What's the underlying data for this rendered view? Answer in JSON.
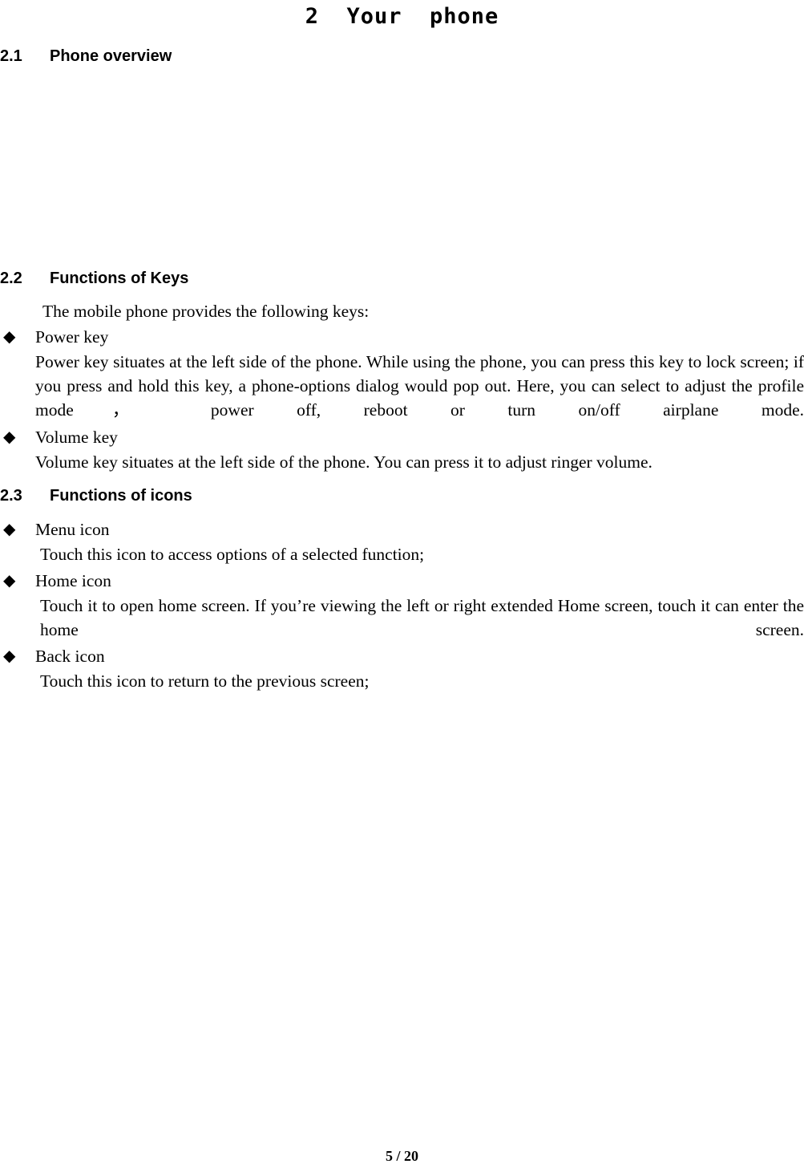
{
  "document": {
    "chapter_title": "2  Your  phone",
    "footer": "5 / 20"
  },
  "sections": [
    {
      "number": "2.1",
      "title": "Phone overview"
    },
    {
      "number": "2.2",
      "title": "Functions of Keys",
      "intro": "The mobile phone provides the following keys:",
      "items": [
        {
          "bullet": "◆",
          "label": "Power key",
          "body": "Power key situates at the left side of the phone. While using the phone, you can press this key to lock screen; if you press and hold this key, a phone-options dialog would pop out. Here, you can select to adjust the profile mode， power off, reboot or turn on/off airplane mode."
        },
        {
          "bullet": "◆",
          "label": "Volume key",
          "body": "Volume key situates at the left side of the phone. You can press it to adjust ringer volume."
        }
      ]
    },
    {
      "number": "2.3",
      "title": "Functions of icons",
      "items": [
        {
          "bullet": "◆",
          "label": "Menu icon",
          "body": "Touch this icon to access options of a selected function;"
        },
        {
          "bullet": "◆",
          "label": "Home icon",
          "body": "Touch it to open home screen. If you’re viewing the left or right extended Home screen, touch it can enter the home screen."
        },
        {
          "bullet": "◆",
          "label": "Back icon",
          "body": "Touch this icon to return to the previous screen;"
        }
      ]
    }
  ]
}
